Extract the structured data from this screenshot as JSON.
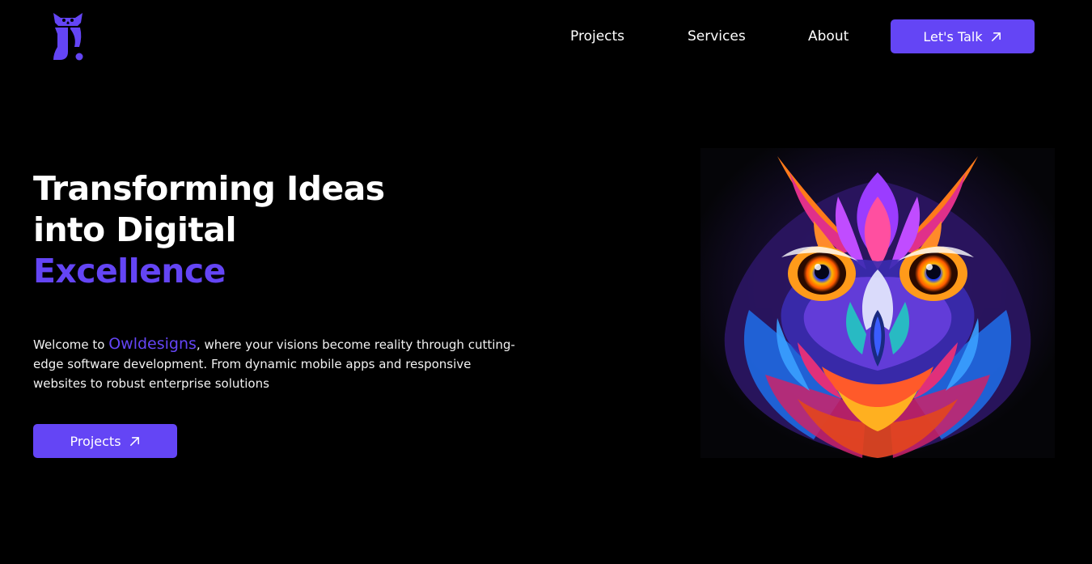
{
  "header": {
    "logo_icon": "owl-logo-icon",
    "nav": {
      "projects": "Projects",
      "services": "Services",
      "about": "About"
    },
    "cta_label": "Let's Talk",
    "cta_icon": "arrow-up-right-icon"
  },
  "hero": {
    "headline_line1": "Transforming Ideas",
    "headline_line2": "into Digital",
    "headline_accent": "Excellence",
    "intro_prefix": "Welcome to ",
    "intro_brand": "Owldesigns",
    "intro_suffix": ", where your visions become reality through cutting-edge software development. From dynamic mobile apps and responsive websites to robust enterprise solutions",
    "button_label": "Projects",
    "button_icon": "arrow-up-right-icon",
    "image": "colorful-owl-illustration"
  },
  "colors": {
    "background": "#000000",
    "accent": "#6445f5",
    "text": "#ffffff"
  }
}
